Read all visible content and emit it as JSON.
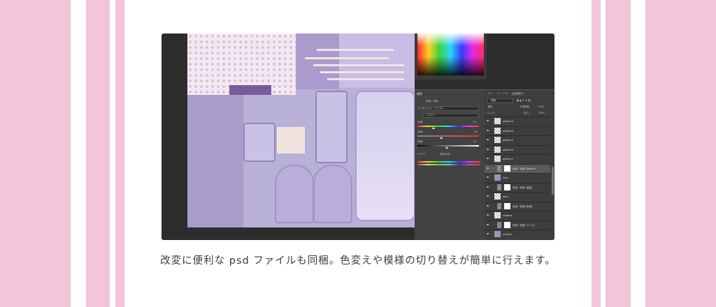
{
  "caption": "改変に便利な psd ファイルも同梱。色変えや模様の切り替えが簡単に行えます。",
  "colors": {
    "stripe_pink": "#f3c5da",
    "background": "#ffffff",
    "app_dark": "#2c2c2c",
    "canvas_lavender": "#b9b0d8"
  },
  "properties_panel": {
    "tab": "属性",
    "adjustment_name": "色相・彩度",
    "preset_label": "プリセット：",
    "preset_value": "カスタム",
    "channel_value": "マスター",
    "hue_label": "色相：",
    "hue_value": "92",
    "saturation_label": "彩度：",
    "saturation_value": "-36",
    "lightness_label": "明度：",
    "lightness_value": "41",
    "colorize_label": "色彩の統一"
  },
  "layers_panel": {
    "tabs": [
      "パス",
      "チャンネル",
      "レイヤー"
    ],
    "filter_value": "種類",
    "blend_mode": "通常",
    "opacity_label": "不透明度：",
    "opacity_value": "100%",
    "lock_label": "ロック：",
    "fill_label": "塗り：",
    "fill_value": "100%",
    "layers": [
      {
        "name": "pattern5",
        "thumb": "checker"
      },
      {
        "name": "pattern4",
        "thumb": "checker"
      },
      {
        "name": "pattern3",
        "thumb": "checker"
      },
      {
        "name": "pattern2",
        "thumb": "checker"
      },
      {
        "name": "pattern1",
        "thumb": "checker"
      },
      {
        "name": "色相・彩度 (Pattern)",
        "thumb": "mask"
      },
      {
        "name": "lines",
        "thumb": "img"
      },
      {
        "name": "色相・彩度 (金属)",
        "thumb": "mask"
      },
      {
        "name": "gold",
        "thumb": "checker"
      },
      {
        "name": "色相・彩度 (布地)",
        "thumb": "mask"
      },
      {
        "name": "shadow",
        "thumb": "checker"
      },
      {
        "name": "色相・彩度 (ベース)",
        "thumb": "mask"
      },
      {
        "name": "uvBase",
        "thumb": "img"
      }
    ]
  }
}
